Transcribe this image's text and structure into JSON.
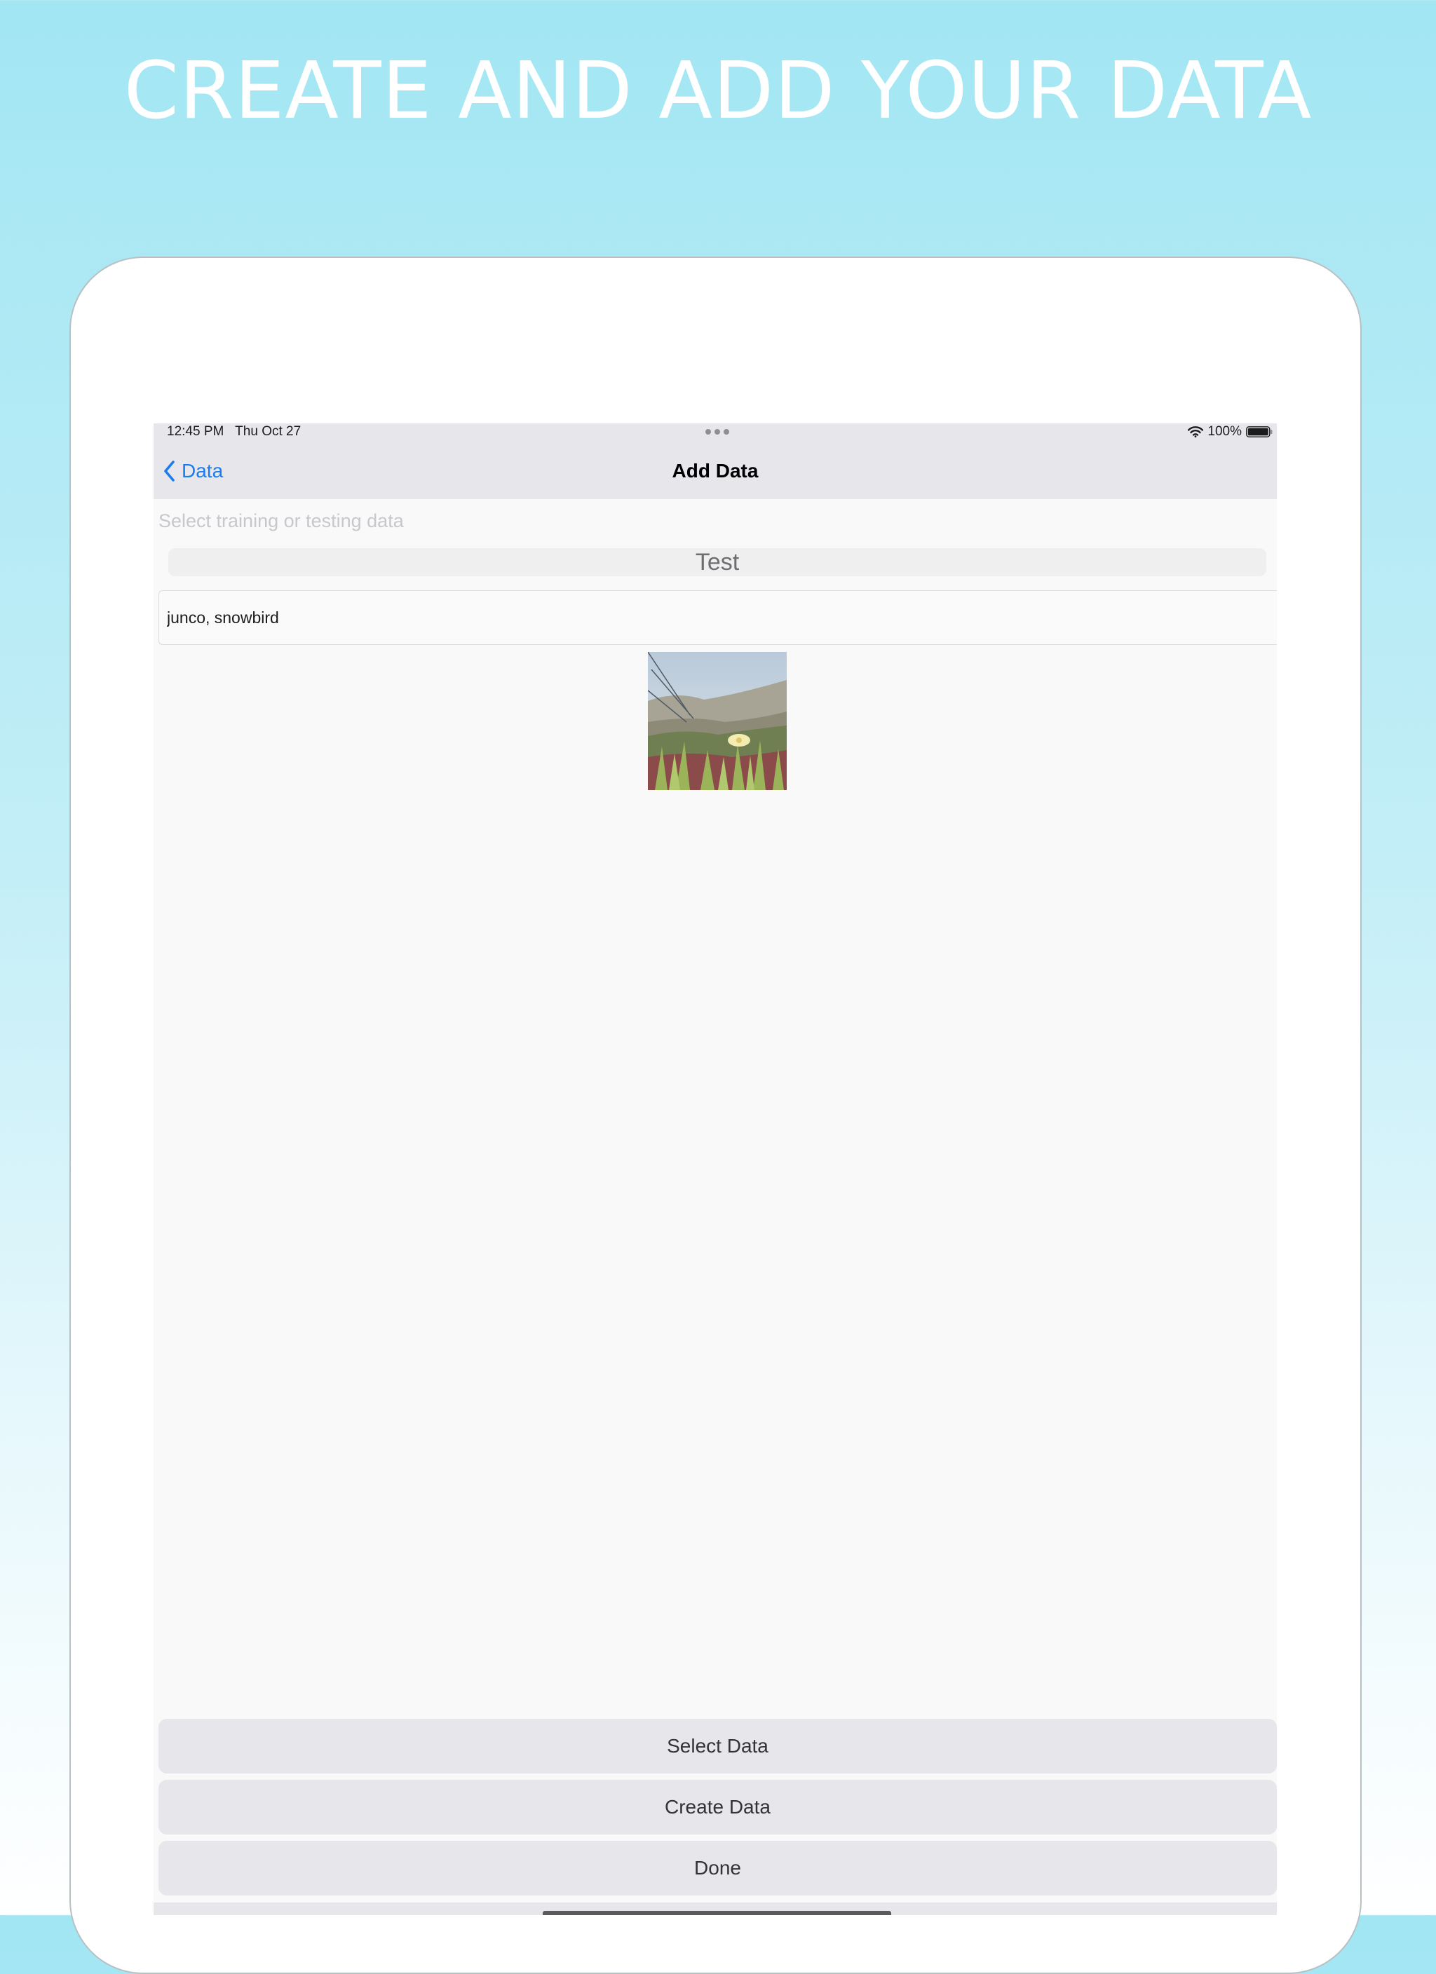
{
  "promo": {
    "headline": "CREATE AND ADD YOUR DATA"
  },
  "status_bar": {
    "time": "12:45 PM",
    "date": "Thu Oct 27",
    "battery": "100%"
  },
  "nav": {
    "back_label": "Data",
    "title": "Add Data"
  },
  "form": {
    "hint": "Select training or testing data",
    "segment_selected": "Test",
    "label_value": "junco, snowbird"
  },
  "buttons": {
    "select_data": "Select Data",
    "create_data": "Create Data",
    "done": "Done"
  },
  "colors": {
    "background_top": "#a2e6f3",
    "accent": "#1a7cf0",
    "bar_gray": "#e6e6eb"
  },
  "icons": [
    "wifi-icon",
    "battery-icon",
    "chevron-left-icon",
    "more-dots-icon"
  ]
}
